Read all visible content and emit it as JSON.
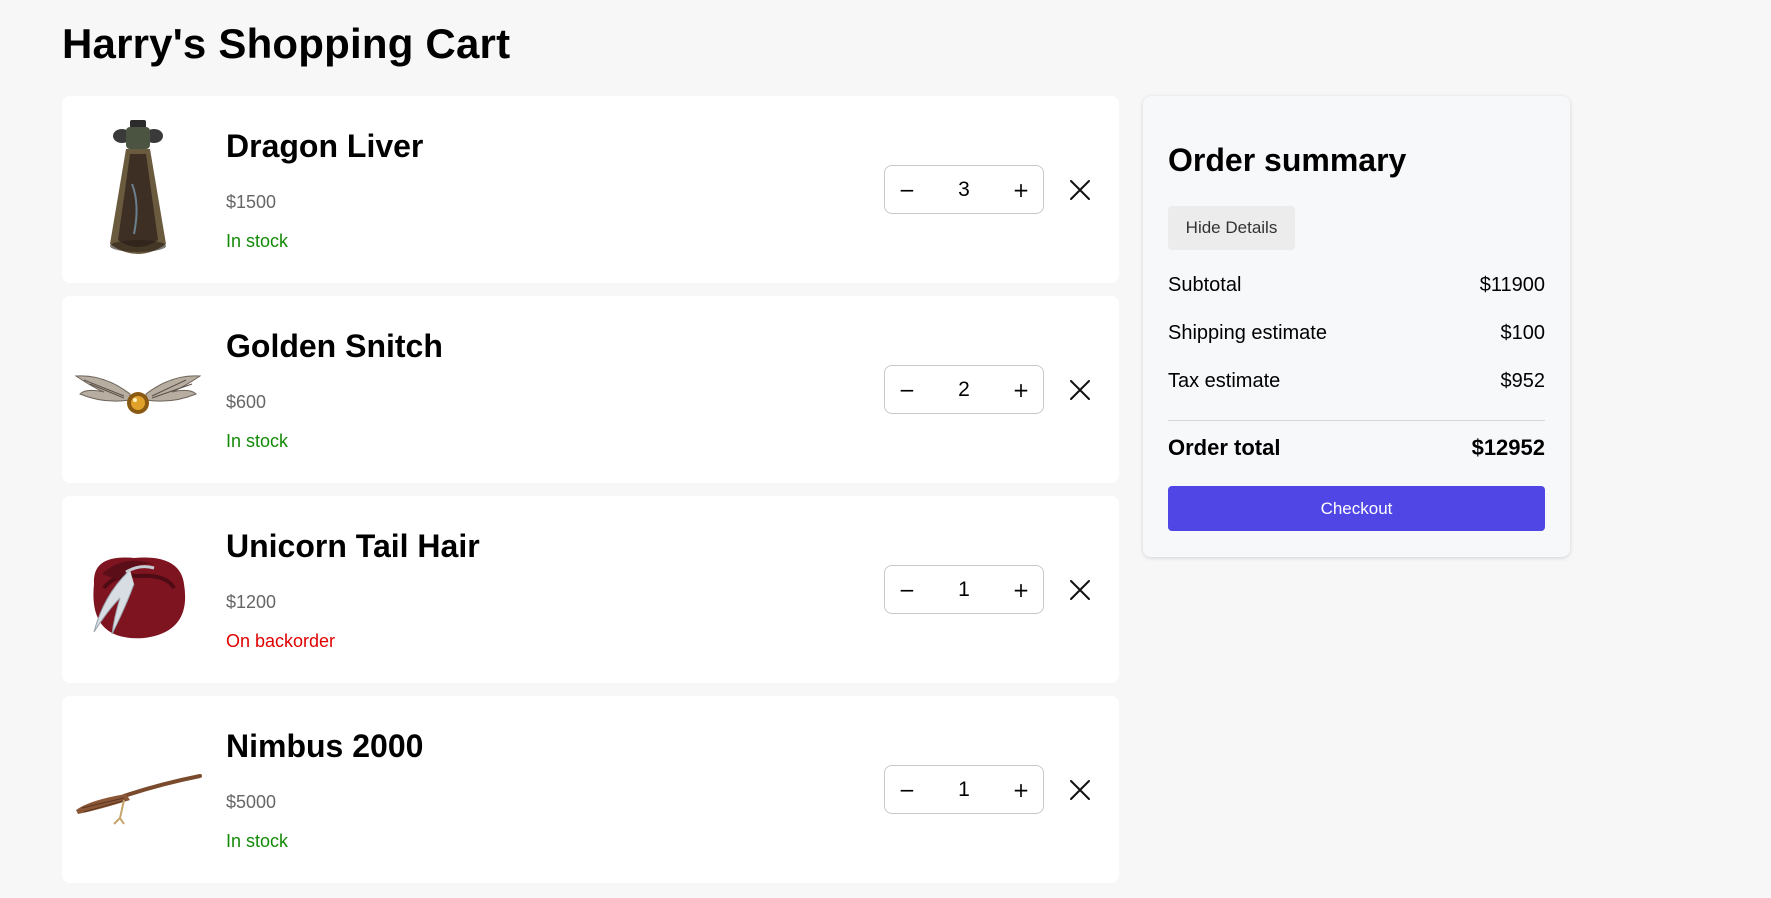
{
  "page": {
    "title": "Harry's Shopping Cart"
  },
  "colors": {
    "in_stock": "#138a07",
    "backorder": "#e00000",
    "checkout": "#4f46e5"
  },
  "cart": {
    "items": [
      {
        "name": "Dragon Liver",
        "price": "$1500",
        "stock": "In stock",
        "stock_status": "in_stock",
        "quantity": "3",
        "minus": "−",
        "plus": "+",
        "image": "potion-bottle-image"
      },
      {
        "name": "Golden Snitch",
        "price": "$600",
        "stock": "In stock",
        "stock_status": "in_stock",
        "quantity": "2",
        "minus": "−",
        "plus": "+",
        "image": "golden-snitch-image"
      },
      {
        "name": "Unicorn Tail Hair",
        "price": "$1200",
        "stock": "On backorder",
        "stock_status": "backorder",
        "quantity": "1",
        "minus": "−",
        "plus": "+",
        "image": "red-pouch-image"
      },
      {
        "name": "Nimbus 2000",
        "price": "$5000",
        "stock": "In stock",
        "stock_status": "in_stock",
        "quantity": "1",
        "minus": "−",
        "plus": "+",
        "image": "broomstick-image"
      }
    ]
  },
  "summary": {
    "title": "Order summary",
    "hide_details": "Hide Details",
    "subtotal_label": "Subtotal",
    "subtotal_value": "$11900",
    "shipping_label": "Shipping estimate",
    "shipping_value": "$100",
    "tax_label": "Tax estimate",
    "tax_value": "$952",
    "total_label": "Order total",
    "total_value": "$12952",
    "checkout_label": "Checkout"
  }
}
